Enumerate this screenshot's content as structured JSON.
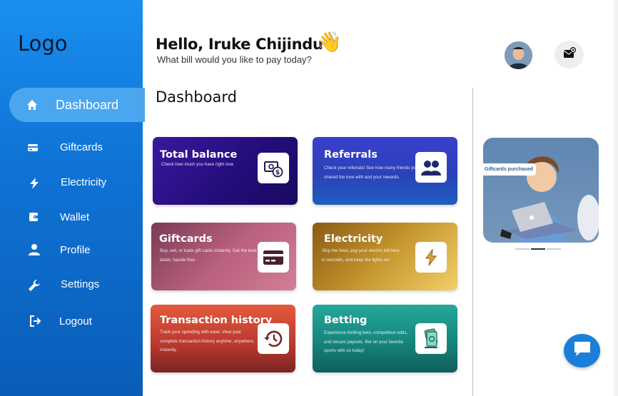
{
  "logo": "Logo",
  "sidebar": {
    "items": [
      {
        "label": "Dashboard",
        "icon": "home-icon"
      },
      {
        "label": "Giftcards",
        "icon": "card-icon"
      },
      {
        "label": "Electricity",
        "icon": "bolt-icon"
      },
      {
        "label": "Wallet",
        "icon": "wallet-icon"
      },
      {
        "label": "Profile",
        "icon": "user-icon"
      },
      {
        "label": "Settings",
        "icon": "wrench-icon"
      },
      {
        "label": "Logout",
        "icon": "logout-icon"
      }
    ]
  },
  "header": {
    "greeting": "Hello, Iruke Chijindu !",
    "wave": "👋",
    "subtitle": "What bill would you like to pay today?"
  },
  "main": {
    "title": "Dashboard",
    "cards": [
      {
        "title": "Total balance",
        "desc": "Check how much you have right now",
        "icon": "money-icon"
      },
      {
        "title": "Referrals",
        "desc": "Check your referrals! See how many friends you've shared the love with and your rewards.",
        "icon": "people-icon"
      },
      {
        "title": "Giftcards",
        "desc": "Buy, sell, or trade gift cards instantly. Get the best deals, hassle-free.",
        "icon": "credit-card-icon"
      },
      {
        "title": "Electricity",
        "desc": "Skip the lines, pay your electric bill here in seconds, and keep the lights on!",
        "icon": "bolt-icon"
      },
      {
        "title": "Transaction history",
        "desc": "Track your spending with ease. View your complete transaction history anytime, anywhere, instantly.",
        "icon": "history-icon"
      },
      {
        "title": "Betting",
        "desc": "Experience thrilling bets, competitive odds, and secure payouts. Bet on your favorite sports with us today!",
        "icon": "cash-icon"
      }
    ]
  },
  "banner": {
    "tag": "Giftcards purchased",
    "active_slide": 2,
    "slide_count": 3
  },
  "colors": {
    "sidebar": "#1a8ff0",
    "accent": "#1b7fd8"
  }
}
